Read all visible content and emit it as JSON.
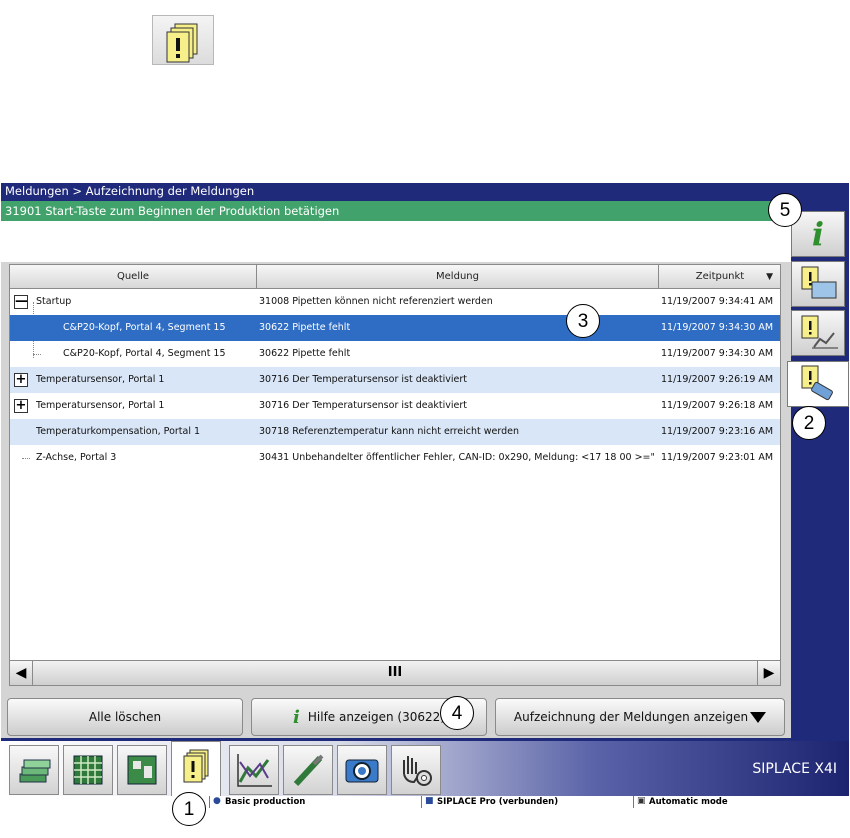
{
  "breadcrumb": "Meldungen > Aufzeichnung der Meldungen",
  "status_message": "31901 Start-Taste zum Beginnen der Produktion betätigen",
  "columns": {
    "source": "Quelle",
    "message": "Meldung",
    "time": "Zeitpunkt"
  },
  "rows": [
    {
      "source": "Startup",
      "message": "31008 Pipetten können nicht referenziert werden",
      "time": "11/19/2007 9:34:41 AM",
      "expander": "—"
    },
    {
      "source": "C&P20-Kopf, Portal 4, Segment 15",
      "message": "30622 Pipette fehlt",
      "time": "11/19/2007 9:34:30 AM",
      "expander": ""
    },
    {
      "source": "C&P20-Kopf, Portal 4, Segment 15",
      "message": "30622 Pipette fehlt",
      "time": "11/19/2007 9:34:30 AM",
      "expander": ""
    },
    {
      "source": "Temperatursensor, Portal 1",
      "message": "30716 Der Temperatursensor ist deaktiviert",
      "time": "11/19/2007 9:26:19 AM",
      "expander": "+"
    },
    {
      "source": "Temperatursensor, Portal 1",
      "message": "30716 Der Temperatursensor ist deaktiviert",
      "time": "11/19/2007 9:26:18 AM",
      "expander": "+"
    },
    {
      "source": "Temperaturkompensation, Portal 1",
      "message": "30718 Referenztemperatur kann nicht erreicht werden",
      "time": "11/19/2007 9:23:16 AM",
      "expander": ""
    },
    {
      "source": "Z-Achse, Portal 3",
      "message": "30431 Unbehandelter öffentlicher Fehler, CAN-ID: 0x290, Meldung: <17 18 00 >=\"",
      "time": "11/19/2007 9:23:01 AM",
      "expander": ""
    }
  ],
  "scrollbar": {
    "left": "◀",
    "thumb": "III",
    "right": "▶"
  },
  "buttons": {
    "clear_all": "Alle löschen",
    "help_icon": "i",
    "help": "Hilfe anzeigen (30622)",
    "show_log": "Aufzeichnung der Meldungen anzeigen"
  },
  "brand": "SIPLACE X4I",
  "system_status": {
    "production": "Basic production",
    "connection": "SIPLACE Pro (verbunden)",
    "mode": "Automatic mode"
  },
  "side_info_icon": "i",
  "callouts": [
    "1",
    "2",
    "3",
    "4",
    "5"
  ],
  "colors": {
    "title_bg": "#1f2a7a",
    "status_bg": "#41a36b",
    "selected_row": "#2f6dc4",
    "alt_row": "#d9e6f7"
  }
}
